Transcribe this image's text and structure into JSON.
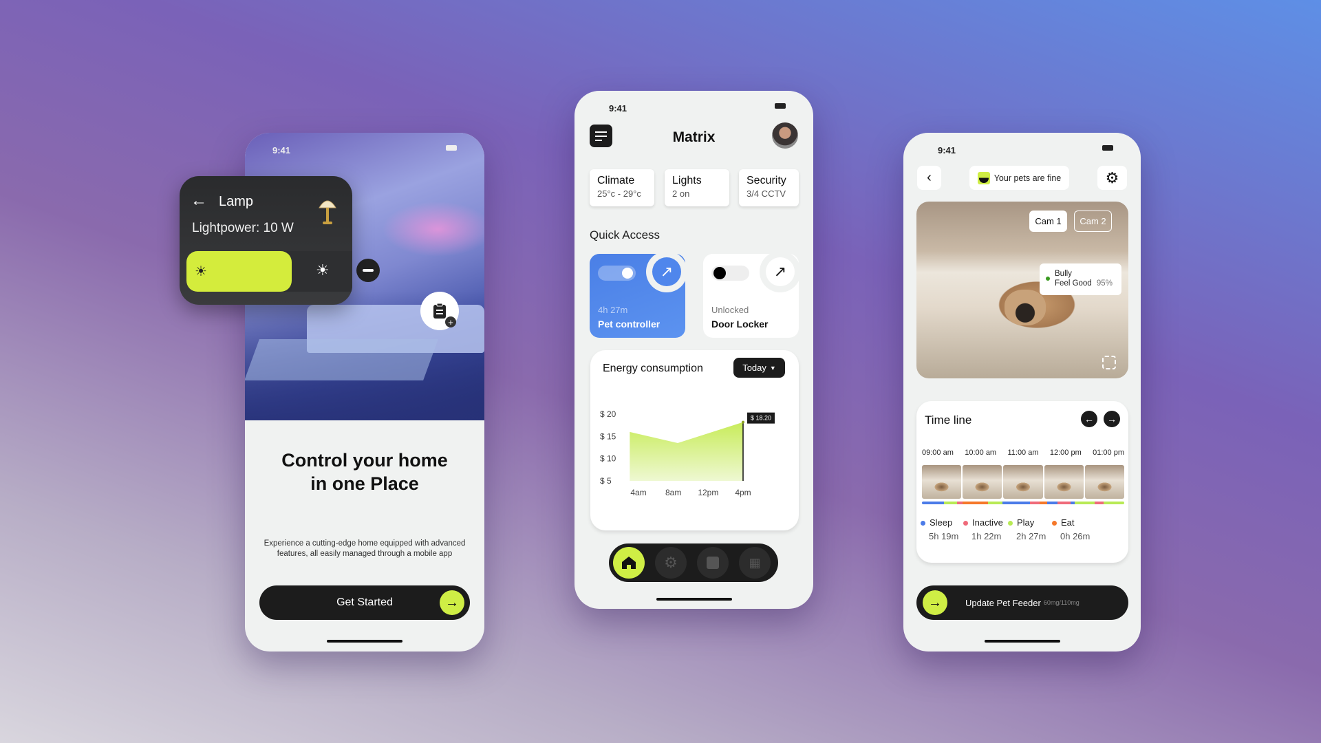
{
  "colors": {
    "accent": "#cfee45",
    "blue": "#4f86ec",
    "dark": "#1c1c1c",
    "sleep": "#4b7be8",
    "inactive": "#ef6a7a",
    "play": "#b8ea55",
    "eat": "#f5782a"
  },
  "phone1": {
    "time": "9:41",
    "title_line1": "Control your home",
    "title_line2": "in one Place",
    "desc_line1": "Experience a cutting-edge home equipped with advanced",
    "desc_line2": "features,  all easily managed through a mobile app",
    "button": "Get Started"
  },
  "lamp": {
    "title": "Lamp",
    "power": "Lightpower: 10 W",
    "brightness": 0.6
  },
  "phone2": {
    "time": "9:41",
    "title": "Matrix",
    "chips": [
      {
        "label": "Climate",
        "value": "25°c - 29°c"
      },
      {
        "label": "Lights",
        "value": "2 on"
      },
      {
        "label": "Security",
        "value": "3/4 CCTV"
      }
    ],
    "quick_access": "Quick Access",
    "pet": {
      "sub": "4h 27m",
      "label": "Pet controller",
      "on": true
    },
    "door": {
      "sub": "Unlocked",
      "label": "Door Locker",
      "on": false
    },
    "energy": {
      "title": "Energy consumption",
      "period": "Today"
    }
  },
  "chart_data": {
    "type": "area",
    "title": "Energy consumption",
    "x_unit": "hour",
    "x": [
      3,
      8.5,
      16
    ],
    "values": [
      16,
      13.5,
      18.2
    ],
    "xticks": [
      "4am",
      "8am",
      "12pm",
      "4pm"
    ],
    "xtick_values": [
      4,
      8,
      12,
      16
    ],
    "yticks": [
      "$ 5",
      "$ 10",
      "$ 15",
      "$ 20"
    ],
    "ytick_values": [
      5,
      10,
      15,
      20
    ],
    "annotation": "$ 18.20",
    "ylim": [
      5,
      20
    ],
    "grid": false
  },
  "phone3": {
    "time": "9:41",
    "status": "Your pets are fine",
    "cams": [
      "Cam 1",
      "Cam 2"
    ],
    "pet_name": "Bully",
    "pet_mood": "Feel Good",
    "pet_mood_pct": "95%",
    "timeline": {
      "title": "Time line",
      "times": [
        "09:00 am",
        "10:00 am",
        "11:00 am",
        "12:00 pm",
        "01:00 pm"
      ],
      "segments": [
        [
          "sleep",
          11
        ],
        [
          "play",
          6.2
        ],
        [
          "inactive",
          2.8
        ],
        [
          "eat",
          12.5
        ],
        [
          "play",
          7.4
        ],
        [
          "sleep",
          13.6
        ],
        [
          "inactive",
          4.5
        ],
        [
          "eat",
          4
        ],
        [
          "sleep",
          5.1
        ],
        [
          "inactive",
          6.2
        ],
        [
          "sleep",
          2.3
        ],
        [
          "play",
          9.6
        ],
        [
          "inactive",
          4.5
        ],
        [
          "play",
          10.3
        ]
      ],
      "legend": [
        {
          "key": "sleep",
          "label": "Sleep",
          "value": "5h 19m"
        },
        {
          "key": "inactive",
          "label": "Inactive",
          "value": "1h 22m"
        },
        {
          "key": "play",
          "label": "Play",
          "value": "2h 27m"
        },
        {
          "key": "eat",
          "label": "Eat",
          "value": "0h 26m"
        }
      ]
    },
    "feeder": {
      "label": "Update Pet Feeder",
      "amount": "60mg/110mg"
    }
  }
}
